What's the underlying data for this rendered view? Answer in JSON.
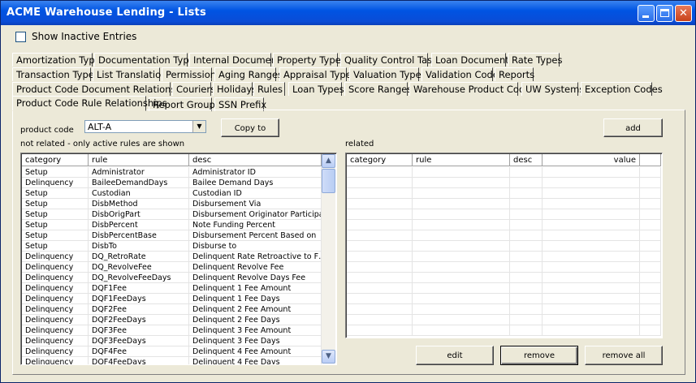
{
  "window": {
    "title": "ACME Warehouse Lending - Lists"
  },
  "options": {
    "show_inactive_label": "Show Inactive Entries"
  },
  "tabs": {
    "row1": [
      "Amortization Types",
      "Documentation Types",
      "Internal Documents",
      "Property Types",
      "Quality Control Tasks",
      "Loan Documents",
      "Rate Types"
    ],
    "row2": [
      "Transaction Types",
      "List Translation",
      "Permissions",
      "Aging Ranges",
      "Appraisal Types",
      "Valuation Types",
      "Validation Codes",
      "Reports"
    ],
    "row3": [
      "Product Code Document Relationships",
      "Couriers",
      "Holidays",
      "Rules",
      "Loan Types",
      "Score Ranges",
      "Warehouse Product Codes",
      "UW Systems",
      "Exception Codes"
    ],
    "row4": [
      "Product Code Rule Relationships",
      "Report Groups",
      "SSN Prefix"
    ]
  },
  "form": {
    "product_code_label": "product code",
    "product_code_value": "ALT-A",
    "copy_to_label": "Copy to",
    "add_label": "add",
    "not_related_label": "not related - only active rules are shown",
    "related_label": "related",
    "edit_label": "edit",
    "remove_label": "remove",
    "remove_all_label": "remove all"
  },
  "left_grid": {
    "headers": [
      "category",
      "rule",
      "desc"
    ],
    "rows": [
      [
        "Setup",
        "Administrator",
        "Administrator ID"
      ],
      [
        "Delinquency",
        "BaileeDemandDays",
        "Bailee Demand Days"
      ],
      [
        "Setup",
        "Custodian",
        "Custodian ID"
      ],
      [
        "Setup",
        "DisbMethod",
        "Disbursement Via"
      ],
      [
        "Setup",
        "DisbOrigPart",
        "Disbursement Originator Participa…"
      ],
      [
        "Setup",
        "DisbPercent",
        "Note Funding Percent"
      ],
      [
        "Setup",
        "DisbPercentBase",
        "Disbursement Percent Based on"
      ],
      [
        "Setup",
        "DisbTo",
        "Disburse to"
      ],
      [
        "Delinquency",
        "DQ_RetroRate",
        "Delinquent Rate Retroactive to F…"
      ],
      [
        "Delinquency",
        "DQ_RevolveFee",
        "Delinquent Revolve Fee"
      ],
      [
        "Delinquency",
        "DQ_RevolveFeeDays",
        "Delinquent Revolve Days Fee"
      ],
      [
        "Delinquency",
        "DQF1Fee",
        "Delinquent 1 Fee Amount"
      ],
      [
        "Delinquency",
        "DQF1FeeDays",
        "Delinquent 1 Fee Days"
      ],
      [
        "Delinquency",
        "DQF2Fee",
        "Delinquent 2 Fee Amount"
      ],
      [
        "Delinquency",
        "DQF2FeeDays",
        "Delinquent 2 Fee Days"
      ],
      [
        "Delinquency",
        "DQF3Fee",
        "Delinquent 3 Fee Amount"
      ],
      [
        "Delinquency",
        "DQF3FeeDays",
        "Delinquent 3 Fee Days"
      ],
      [
        "Delinquency",
        "DQF4Fee",
        "Delinquent 4 Fee Amount"
      ],
      [
        "Delinquency",
        "DQF4FeeDays",
        "Delinquent 4 Fee Days"
      ]
    ]
  },
  "right_grid": {
    "headers": [
      "category",
      "rule",
      "desc",
      "value"
    ]
  }
}
